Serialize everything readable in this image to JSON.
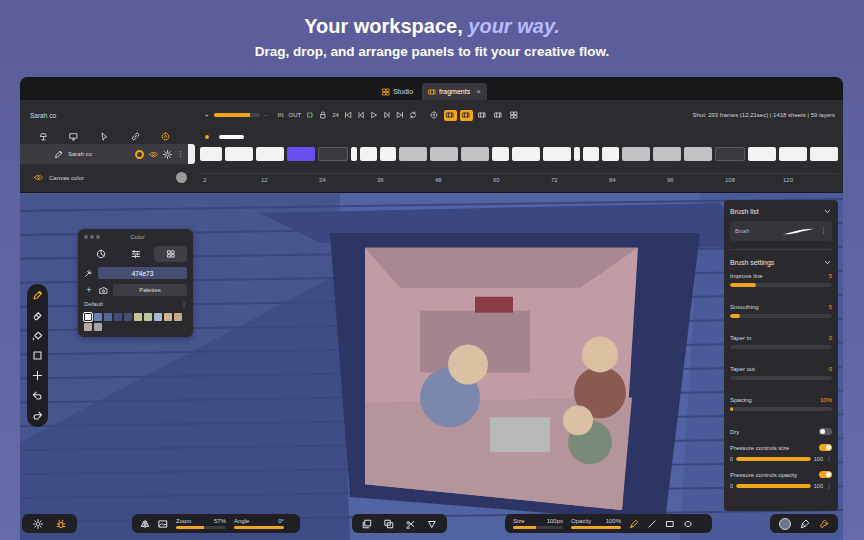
{
  "header": {
    "title": "Your workspace, ",
    "accent": "your way.",
    "subtitle": "Drag, drop, and arrange panels to fit your creative flow."
  },
  "tabs": [
    {
      "label": "Studio",
      "kind": "grid",
      "selected": false
    },
    {
      "label": "fragments",
      "kind": "film",
      "selected": true,
      "close": "×"
    }
  ],
  "timeline": {
    "title": "Sarah co",
    "zoom_in": "+",
    "zoom_out": "-",
    "zoom_level": 0.8,
    "in": "IN",
    "out": "OUT",
    "fps": "24",
    "view_toggles": [
      {
        "kind": "onion",
        "selected": false
      },
      {
        "kind": "film",
        "selected": true
      },
      {
        "kind": "film",
        "selected": true
      },
      {
        "kind": "film",
        "selected": false
      },
      {
        "kind": "film",
        "selected": false
      },
      {
        "kind": "grid",
        "selected": false
      }
    ],
    "shot_info": "Shot: 293 frames (12.21sec) | 1418 sheets | 59 layers",
    "layer_tools": [
      {
        "kind": "lamp",
        "selected": false
      },
      {
        "kind": "monitor",
        "selected": false
      },
      {
        "kind": "cursor",
        "selected": false
      },
      {
        "kind": "link",
        "selected": false
      },
      {
        "kind": "onion",
        "selected": true
      }
    ],
    "layers": [
      {
        "name": "Sarah co",
        "selected": true,
        "onion": true,
        "visible": true,
        "more": "⋮"
      }
    ],
    "canvas_color": {
      "label": "Canvas color",
      "color": "#9b9b9b"
    },
    "frames": [
      {
        "frames": 4,
        "kind": "drawing"
      },
      {
        "frames": 5,
        "kind": "drawing"
      },
      {
        "frames": 5,
        "kind": "drawing"
      },
      {
        "frames": 5,
        "kind": "current"
      },
      {
        "frames": 5,
        "kind": "empty"
      },
      {
        "frames": 1,
        "kind": "drawing"
      },
      {
        "frames": 3,
        "kind": "drawing"
      },
      {
        "frames": 3,
        "kind": "drawing"
      },
      {
        "frames": 5,
        "kind": "hold"
      },
      {
        "frames": 5,
        "kind": "hold"
      },
      {
        "frames": 5,
        "kind": "hold"
      },
      {
        "frames": 3,
        "kind": "drawing"
      },
      {
        "frames": 5,
        "kind": "drawing"
      },
      {
        "frames": 5,
        "kind": "drawing"
      },
      {
        "frames": 1,
        "kind": "drawing"
      },
      {
        "frames": 3,
        "kind": "drawing"
      },
      {
        "frames": 3,
        "kind": "drawing"
      },
      {
        "frames": 5,
        "kind": "hold"
      },
      {
        "frames": 5,
        "kind": "hold"
      },
      {
        "frames": 5,
        "kind": "hold"
      },
      {
        "frames": 5,
        "kind": "empty"
      },
      {
        "frames": 5,
        "kind": "drawing"
      },
      {
        "frames": 5,
        "kind": "drawing"
      },
      {
        "frames": 5,
        "kind": "drawing"
      }
    ],
    "ruler": [
      "2",
      "12",
      "24",
      "36",
      "48",
      "60",
      "72",
      "84",
      "96",
      "108",
      "120"
    ]
  },
  "color_panel": {
    "title": "Color",
    "modes": [
      {
        "kind": "wheel",
        "selected": false
      },
      {
        "kind": "sliders",
        "selected": false
      },
      {
        "kind": "palette",
        "selected": true
      }
    ],
    "hex": "474e73",
    "current": "#474e73",
    "add": "+",
    "palettes": "Palettes",
    "palette": "Default",
    "more": "⋮",
    "swatches": [
      {
        "color": "#ffffff",
        "selected": true
      },
      {
        "color": "#6b80b8",
        "selected": false
      },
      {
        "color": "#55689c",
        "selected": false
      },
      {
        "color": "#414b78",
        "selected": false
      },
      {
        "color": "#474e73",
        "selected": false
      },
      {
        "color": "#c9c39c",
        "selected": false
      },
      {
        "color": "#b7c7a0",
        "selected": false
      },
      {
        "color": "#a3b7cf",
        "selected": false
      },
      {
        "color": "#c9b48f",
        "selected": false
      },
      {
        "color": "#c7a98f",
        "selected": false
      },
      {
        "color": "#b8a9a2",
        "selected": false
      },
      {
        "color": "#a3a3ab",
        "selected": false
      }
    ]
  },
  "tools": [
    {
      "kind": "pencil",
      "selected": true
    },
    {
      "kind": "eraser",
      "selected": false
    },
    {
      "kind": "fill",
      "selected": false
    },
    {
      "kind": "select",
      "selected": false
    },
    {
      "kind": "plus",
      "selected": false
    },
    {
      "kind": "undo",
      "selected": false
    },
    {
      "kind": "redo",
      "selected": false
    }
  ],
  "brush_panel": {
    "list_title": "Brush list",
    "brush": "Brush",
    "more": "⋮",
    "settings_title": "Brush settings",
    "settings": [
      {
        "kind": "slider",
        "label": "Improve line",
        "value": "5",
        "level": 0.25
      },
      {
        "kind": "slider",
        "label": "Smoothing",
        "value": "5",
        "level": 0.1
      },
      {
        "kind": "slider",
        "label": "Taper in",
        "value": "0",
        "level": 0
      },
      {
        "kind": "slider",
        "label": "Taper out",
        "value": "0",
        "level": 0
      },
      {
        "kind": "slider",
        "label": "Spacing",
        "value": "10%",
        "level": 0.03
      },
      {
        "kind": "toggle",
        "label": "Dry",
        "on": false
      },
      {
        "kind": "range",
        "label": "Pressure controls size",
        "on": true,
        "min": "0",
        "max": "100",
        "level": 1,
        "more": "⋮"
      },
      {
        "kind": "range",
        "label": "Pressure controls opacity",
        "on": true,
        "min": "0",
        "max": "100",
        "level": 1,
        "more": "⋮"
      }
    ]
  },
  "bottom": {
    "app_tools": [
      {
        "kind": "gear",
        "selected": false
      },
      {
        "kind": "bug",
        "selected": true
      }
    ],
    "view_tools": [
      {
        "kind": "flip",
        "selected": false
      },
      {
        "kind": "image",
        "selected": false
      }
    ],
    "zoom": {
      "label": "Zoom",
      "value": "57%",
      "level": 0.55
    },
    "angle": {
      "label": "Angle",
      "value": "0°",
      "level": 1
    },
    "edit_tools": [
      {
        "kind": "layers",
        "selected": false
      },
      {
        "kind": "copy",
        "selected": false
      },
      {
        "kind": "scissors",
        "selected": false
      },
      {
        "kind": "triangle",
        "selected": false
      }
    ],
    "size": {
      "label": "Size",
      "value": "100px",
      "level": 0.45
    },
    "opacity": {
      "label": "Opacity",
      "value": "100%",
      "level": 1
    },
    "shape_tools": [
      {
        "kind": "pen",
        "selected": true
      },
      {
        "kind": "line",
        "selected": false
      },
      {
        "kind": "rect",
        "selected": false
      },
      {
        "kind": "ellipse",
        "selected": false
      }
    ],
    "panel_tools": [
      {
        "kind": "color",
        "selected": false,
        "color": "#6f7290"
      },
      {
        "kind": "brush",
        "selected": false
      },
      {
        "kind": "wrench",
        "selected": true
      }
    ]
  }
}
